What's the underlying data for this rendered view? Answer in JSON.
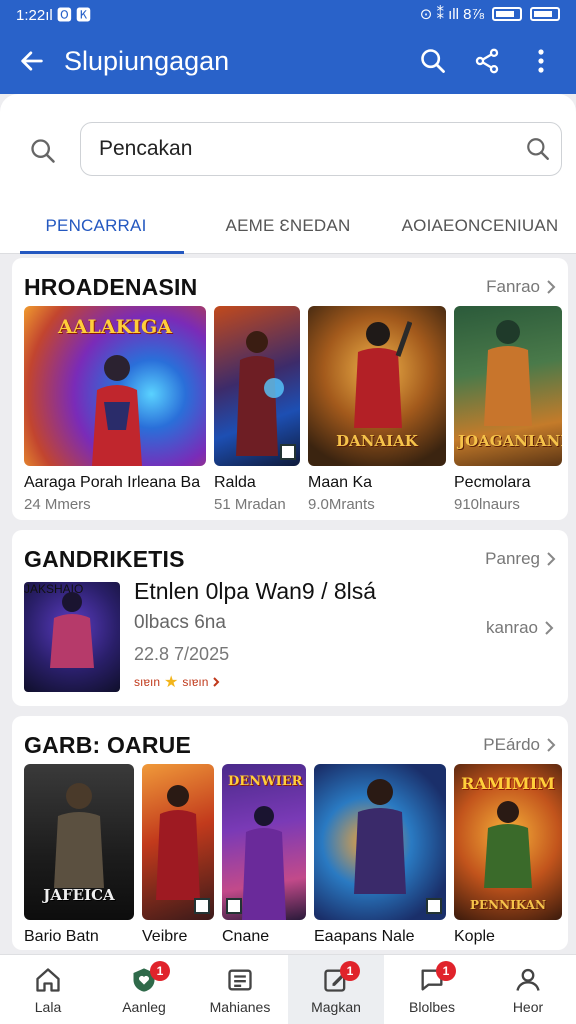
{
  "status_bar": {
    "time": "1:22ıl 🅾 🅺",
    "indicators": "⊙ ⁑ ıll 8⅞"
  },
  "app_bar": {
    "title": "Slupiungagan"
  },
  "search": {
    "placeholder": "Pencakan",
    "value": "Pencakan"
  },
  "tabs": [
    {
      "label": "PENCARRAI",
      "active": true
    },
    {
      "label": "AEME ƐNEDAN",
      "active": false
    },
    {
      "label": "AOIAEONCENIUAN",
      "active": false
    }
  ],
  "section1": {
    "title": "HROADENASIN",
    "more": "Fanrao",
    "items": [
      {
        "name": "Aaraga Porah Irleana Ba",
        "meta": "24 Mmers",
        "poster_label": "AALAKIGA"
      },
      {
        "name": "Ralda",
        "meta": "51 Mradan",
        "poster_label": ""
      },
      {
        "name": "Maan Ka",
        "meta": "9.0Mrants",
        "poster_label": "DANAIAK"
      },
      {
        "name": "Pecmolara",
        "meta": "910lnaurs",
        "poster_label": "JOAGANIANE"
      }
    ]
  },
  "section2": {
    "title": "GANDRIKETIS",
    "more": "Panreg",
    "featured": {
      "title": "Etnlen 0lpa Wan9 / 8lsá",
      "subtitle": "0lbacs 6na",
      "date": "22.8 7/2025",
      "rating_left": "sıɐın",
      "rating_right": "sıɐın",
      "action": "kanrao",
      "poster_label": "JAKSHAIO"
    }
  },
  "section3": {
    "title": "GARB: OARUE",
    "more": "PEárdo",
    "items": [
      {
        "name": "Bario Batn",
        "poster_label": "JAFEICA"
      },
      {
        "name": "Veibre",
        "poster_label": ""
      },
      {
        "name": "Cnane",
        "poster_label": "DENWIER"
      },
      {
        "name": "Eaapans Nale",
        "poster_label": ""
      },
      {
        "name": "Kople",
        "poster_label": "RAMIMIM",
        "poster_bottom": "PENNIKAN"
      }
    ]
  },
  "bottom_nav": [
    {
      "label": "Lala",
      "icon": "home-icon",
      "badge": ""
    },
    {
      "label": "Aanleg",
      "icon": "heart-shield-icon",
      "badge": "1"
    },
    {
      "label": "Mahianes",
      "icon": "list-icon",
      "badge": ""
    },
    {
      "label": "Magkan",
      "icon": "edit-doc-icon",
      "badge": "1",
      "active": true
    },
    {
      "label": "Blolbes",
      "icon": "chat-icon",
      "badge": "1"
    },
    {
      "label": "Heor",
      "icon": "user-icon",
      "badge": ""
    }
  ],
  "colors": {
    "primary": "#2962c9",
    "accent": "#2458c0",
    "badge": "#e0232b"
  }
}
